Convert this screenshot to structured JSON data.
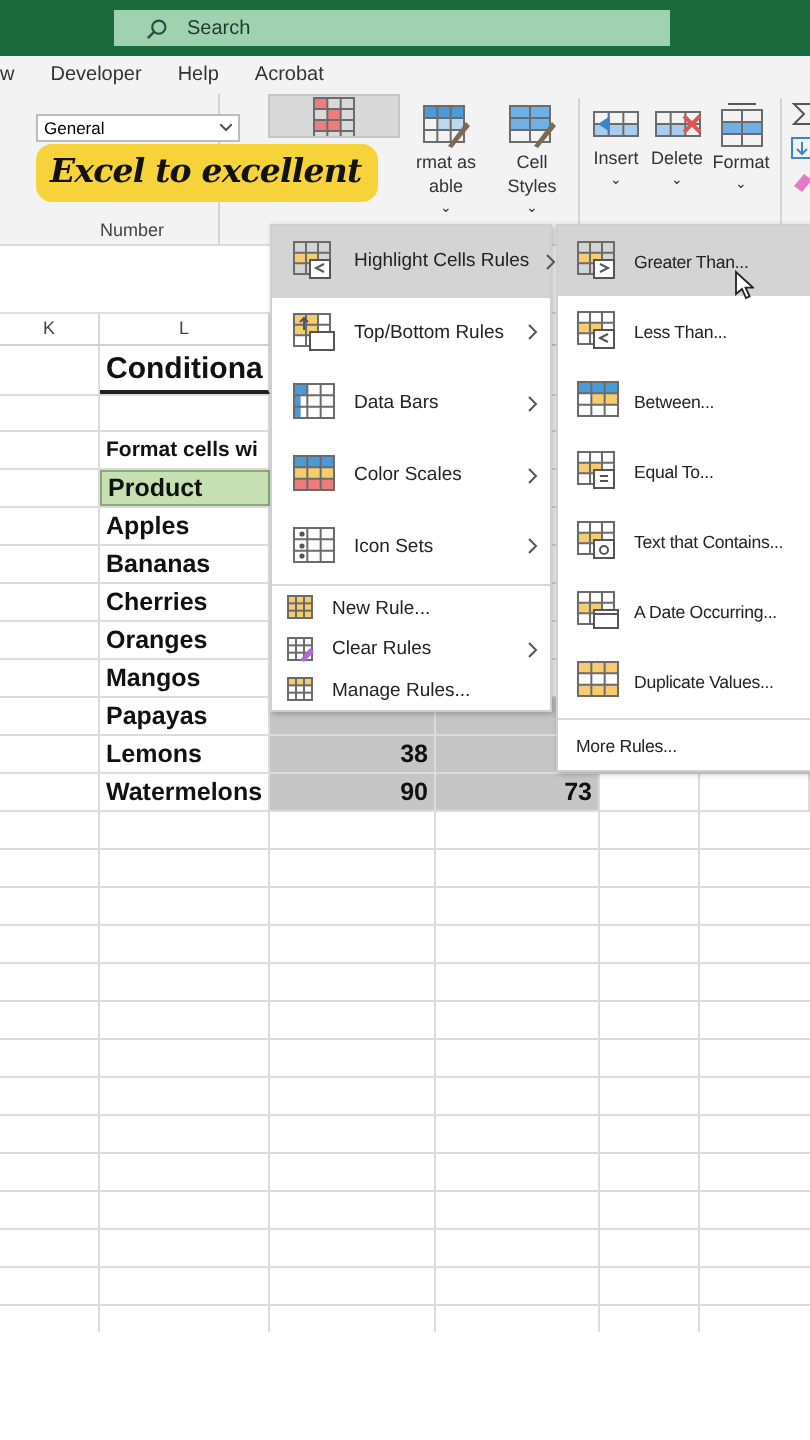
{
  "title_bar": {
    "search": {
      "placeholder": "Search"
    }
  },
  "ribbon_tabs": [
    {
      "label": "w"
    },
    {
      "label": "Developer"
    },
    {
      "label": "Help"
    },
    {
      "label": "Acrobat"
    }
  ],
  "ribbon": {
    "number_format": "General",
    "number_group_label": "Number",
    "buttons": [
      {
        "kind": "conditional",
        "pressed": true
      },
      {
        "kind": "table",
        "pressed": false,
        "lines": [
          "rmat as",
          "able"
        ],
        "caret": "⌄"
      },
      {
        "kind": "styles",
        "pressed": false,
        "lines": [
          "Cell",
          "Styles"
        ],
        "caret": "⌄"
      },
      {
        "kind": "insert",
        "pressed": false,
        "lines": [
          "Insert"
        ],
        "caret": "⌄"
      },
      {
        "kind": "delete",
        "pressed": false,
        "lines": [
          "Delete"
        ],
        "caret": "⌄"
      },
      {
        "kind": "format",
        "pressed": false,
        "lines": [
          "Format"
        ],
        "caret": "⌄"
      }
    ]
  },
  "badge": "Excel to excellent",
  "sheet": {
    "columns": [
      "K",
      "L"
    ],
    "rows": [
      {
        "kind": "title",
        "l": "Conditiona"
      },
      {
        "kind": "blank"
      },
      {
        "kind": "caption",
        "l": "Format cells wi"
      },
      {
        "kind": "header",
        "l": "Product"
      },
      {
        "kind": "data",
        "l": "Apples"
      },
      {
        "kind": "data",
        "l": "Bananas"
      },
      {
        "kind": "data",
        "l": "Cherries"
      },
      {
        "kind": "data",
        "l": "Oranges"
      },
      {
        "kind": "data",
        "l": "Mangos"
      },
      {
        "kind": "data",
        "l": "Papayas",
        "selected": true
      },
      {
        "kind": "data",
        "l": "Lemons",
        "m": "38",
        "selected": true
      },
      {
        "kind": "data",
        "l": "Watermelons",
        "m": "90",
        "n": "73",
        "selected": true
      }
    ]
  },
  "menu": {
    "items": [
      {
        "kind": "large",
        "label": "Highlight Cells Rules",
        "selected": true,
        "submenu": true
      },
      {
        "kind": "large",
        "label": "Top/Bottom Rules",
        "selected": false,
        "submenu": true
      },
      {
        "kind": "large",
        "label": "Data Bars",
        "selected": false,
        "submenu": true
      },
      {
        "kind": "large",
        "label": "Color Scales",
        "selected": false,
        "submenu": true
      },
      {
        "kind": "large",
        "label": "Icon Sets",
        "selected": false,
        "submenu": true
      },
      {
        "kind": "small",
        "label": "New Rule...",
        "selected": false,
        "submenu": false
      },
      {
        "kind": "small",
        "label": "Clear Rules",
        "selected": false,
        "submenu": true
      },
      {
        "kind": "small",
        "label": "Manage Rules...",
        "selected": false,
        "submenu": false
      }
    ]
  },
  "submenu": {
    "items": [
      {
        "kind": "large",
        "label": "Greater Than...",
        "selected": true
      },
      {
        "kind": "large",
        "label": "Less Than...",
        "selected": false
      },
      {
        "kind": "large",
        "label": "Between...",
        "selected": false
      },
      {
        "kind": "large",
        "label": "Equal To...",
        "selected": false
      },
      {
        "kind": "large",
        "label": "Text that Contains...",
        "selected": false
      },
      {
        "kind": "large",
        "label": "A Date Occurring...",
        "selected": false
      },
      {
        "kind": "large",
        "label": "Duplicate Values...",
        "selected": false
      },
      {
        "kind": "text",
        "label": "More Rules...",
        "selected": false
      }
    ]
  }
}
